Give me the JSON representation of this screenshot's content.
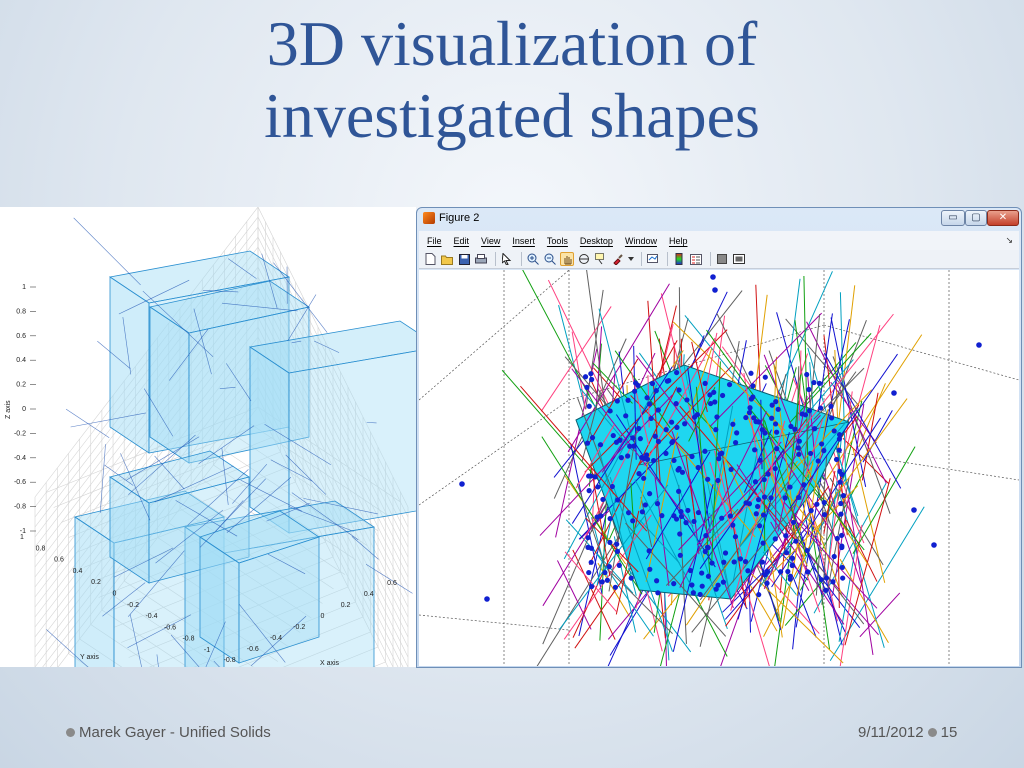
{
  "slide": {
    "title_line1": "3D visualization of",
    "title_line2": "investigated shapes",
    "footer_author": "Marek Gayer - Unified Solids",
    "footer_date": "9/11/2012",
    "footer_page": "15"
  },
  "left_plot": {
    "z_ticks": [
      "1",
      "0.8",
      "0.6",
      "0.4",
      "0.2",
      "0",
      "-0.2",
      "-0.4",
      "-0.6",
      "-0.8",
      "-1"
    ],
    "y_ticks": [
      "1",
      "0.8",
      "0.6",
      "0.4",
      "0.2",
      "0",
      "-0.2",
      "-0.4",
      "-0.6",
      "-0.8",
      "-1"
    ],
    "x_ticks": [
      "0.6",
      "0.4",
      "0.2",
      "0",
      "-0.2",
      "-0.4",
      "-0.6",
      "-0.8",
      "-1"
    ],
    "z_label": "Z axis",
    "y_label": "Y axis",
    "x_label": "X axis",
    "colors": {
      "fill": "#9fdcf5",
      "edge": "#2a8fd0",
      "mesh": "#1a4fb0"
    }
  },
  "figure_window": {
    "title": "Figure 2",
    "controls": {
      "minimize": "▭",
      "maximize": "▢",
      "close": "✕"
    },
    "menu": [
      "File",
      "Edit",
      "View",
      "Insert",
      "Tools",
      "Desktop",
      "Window",
      "Help"
    ],
    "menu_dock": "↘",
    "toolbar_icons": [
      "new-file-icon",
      "open-folder-icon",
      "save-icon",
      "print-icon",
      "select-arrow-icon",
      "zoom-in-icon",
      "zoom-out-icon",
      "pan-hand-icon",
      "rotate-3d-icon",
      "data-cursor-icon",
      "brush-icon",
      "link-plot-icon",
      "colorbar-icon",
      "legend-icon",
      "hide-plot-tools-icon",
      "show-plot-tools-icon"
    ],
    "colors": {
      "solid": "#1fd6f0",
      "points": "#1020d0"
    }
  }
}
